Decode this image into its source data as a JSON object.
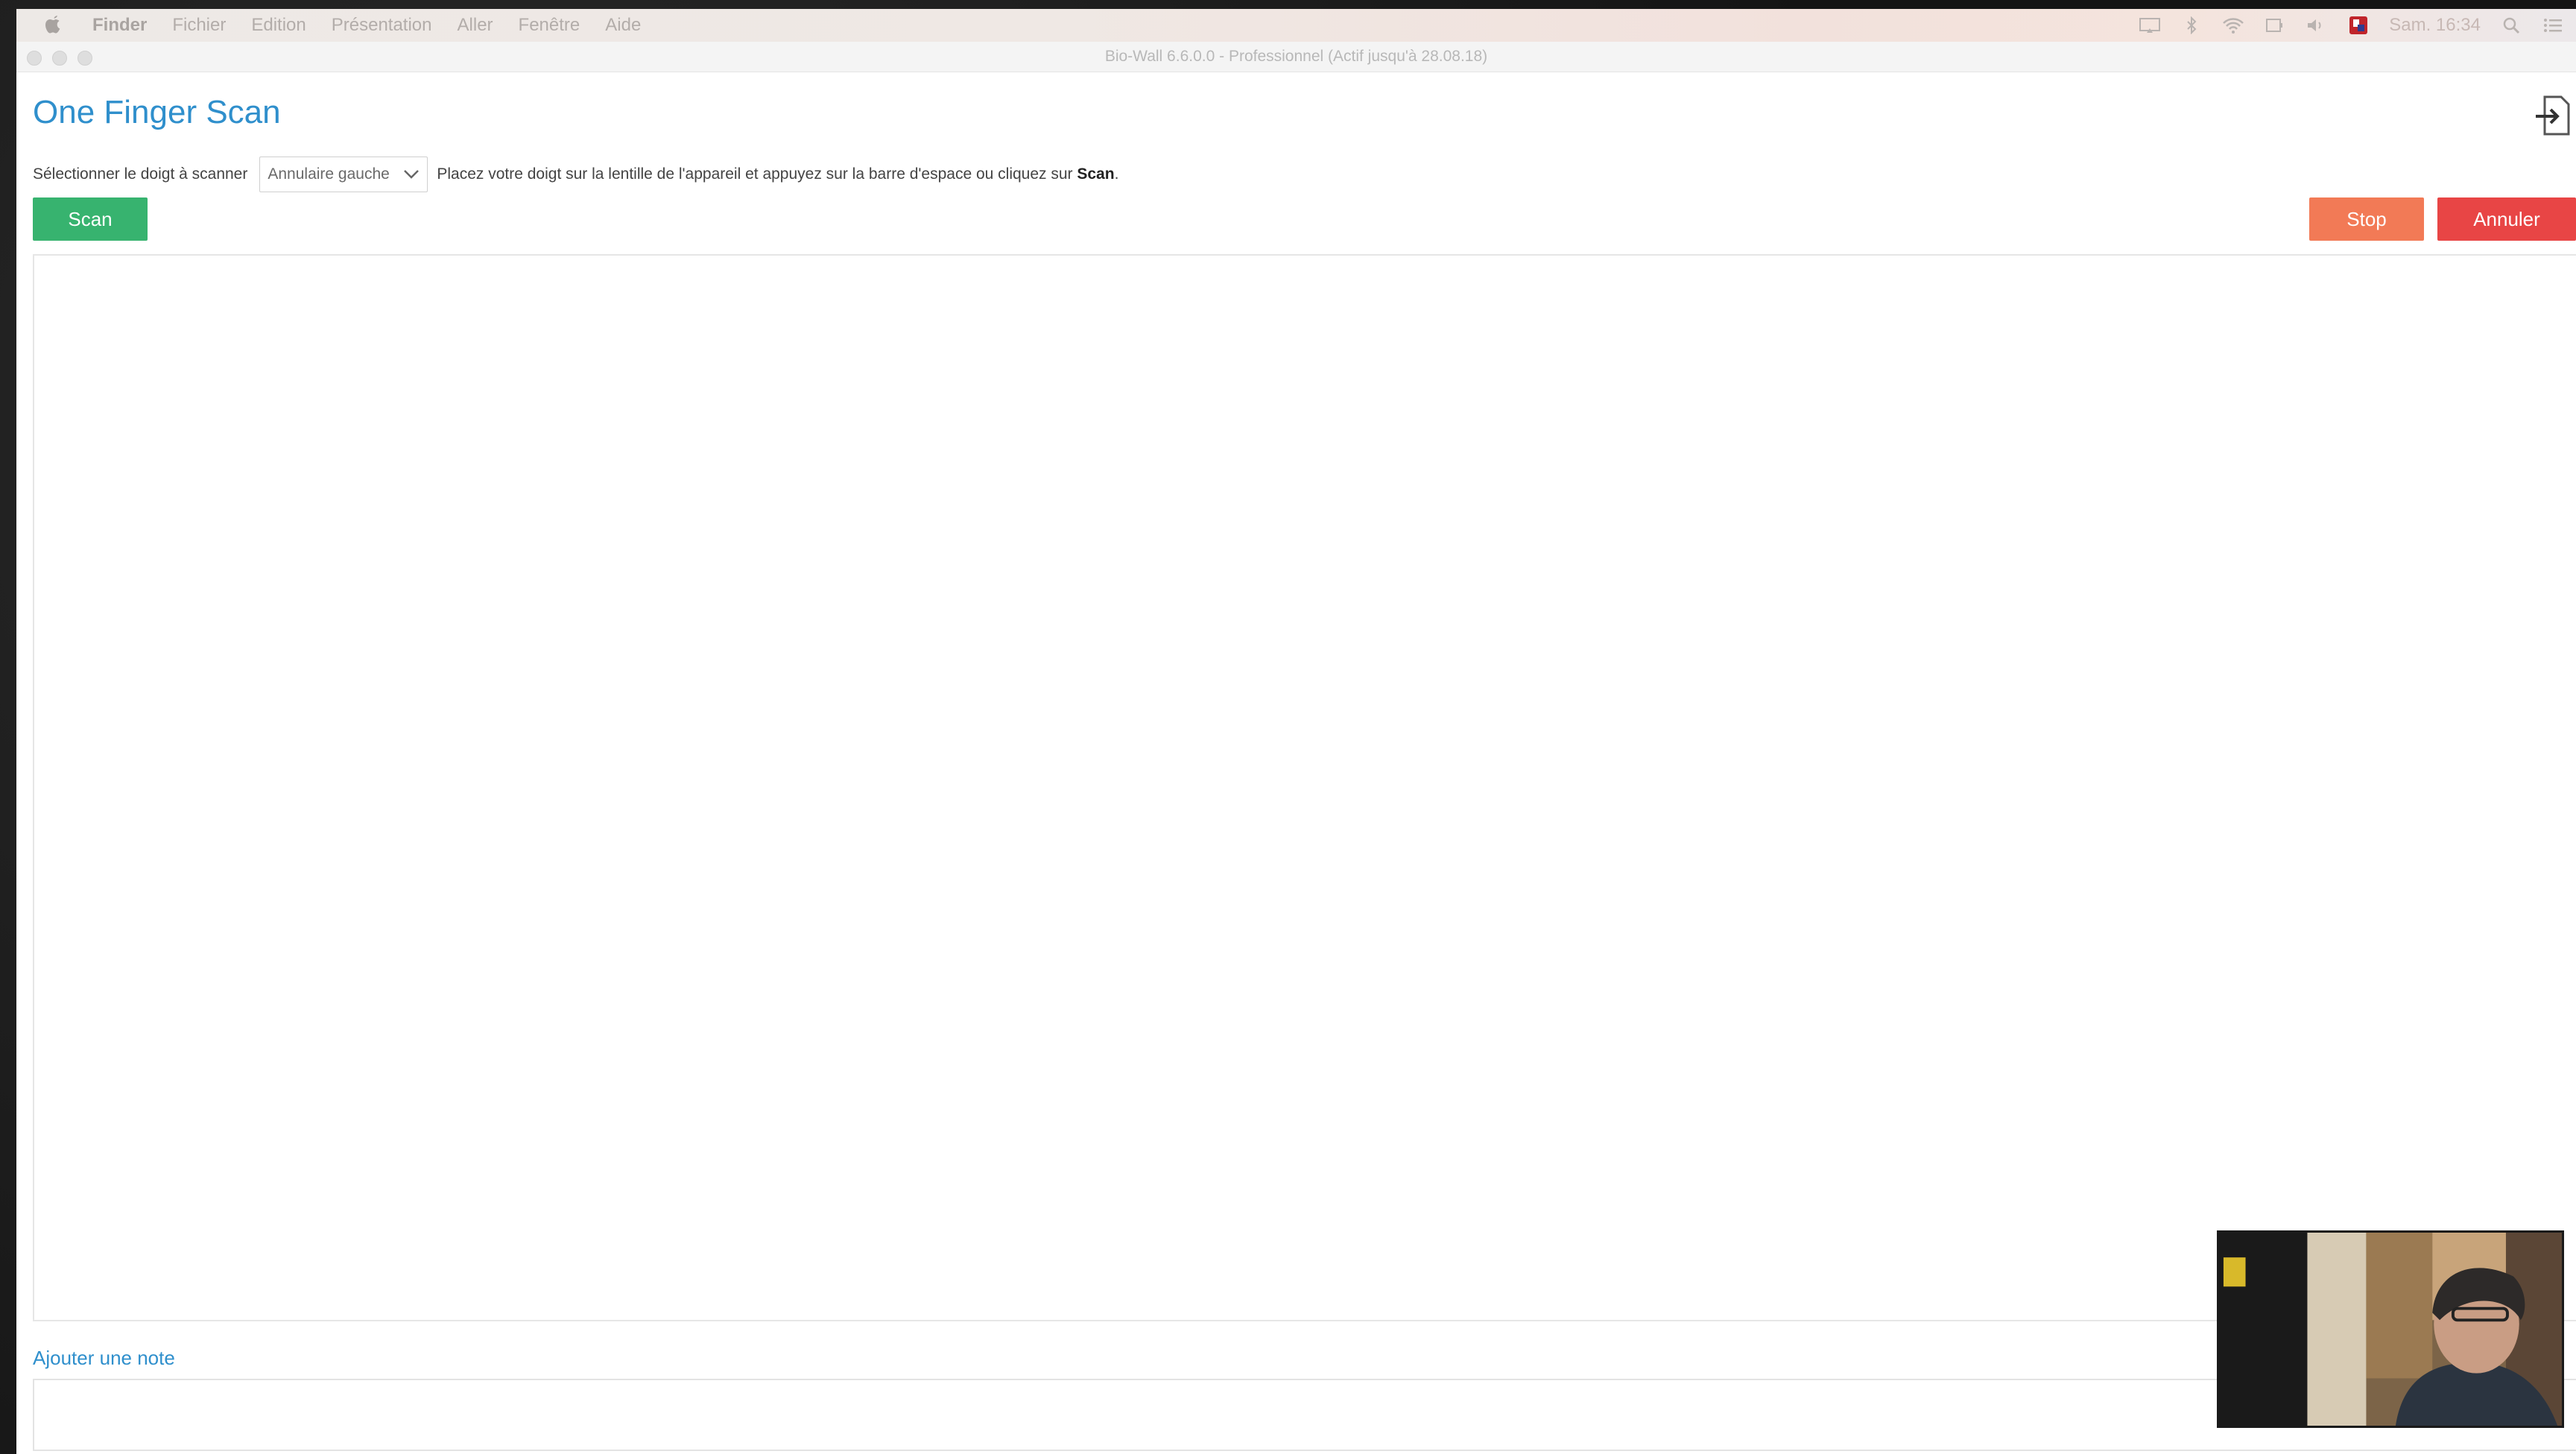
{
  "menubar": {
    "items": [
      "Finder",
      "Fichier",
      "Edition",
      "Présentation",
      "Aller",
      "Fenêtre",
      "Aide"
    ],
    "clock": "Sam. 16:34"
  },
  "window": {
    "title": "Bio-Wall 6.6.0.0 - Professionnel (Actif jusqu'à 28.08.18)"
  },
  "page": {
    "title": "One Finger Scan",
    "select_label": "Sélectionner le doigt à scanner",
    "finger_select_value": "Annulaire gauche",
    "instruction_prefix": "Placez votre doigt sur la lentille de l'appareil et appuyez sur la barre d'espace ou cliquez sur",
    "instruction_strong": "Scan",
    "instruction_suffix": "."
  },
  "buttons": {
    "scan": "Scan",
    "stop": "Stop",
    "cancel": "Annuler"
  },
  "note": {
    "label": "Ajouter une note",
    "value": ""
  },
  "colors": {
    "title_blue": "#2f8fcc",
    "scan_green": "#37b36f",
    "stop_orange": "#f27a56",
    "cancel_red": "#e84545"
  },
  "icons": [
    "apple-icon",
    "screen-mirror-icon",
    "bluetooth-icon",
    "wifi-icon",
    "battery-icon",
    "volume-icon",
    "app-badge-icon",
    "spotlight-icon",
    "notification-center-icon",
    "export-icon",
    "chevron-down-icon"
  ]
}
